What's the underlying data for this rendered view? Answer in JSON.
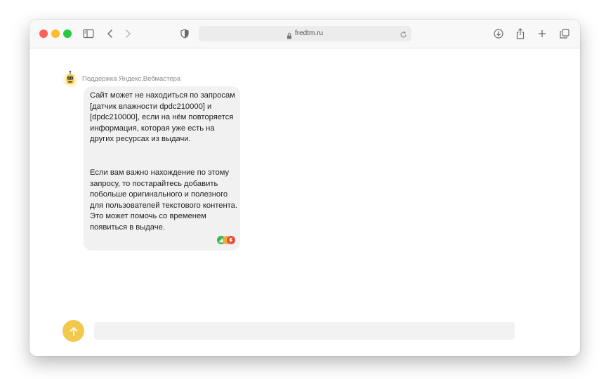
{
  "browser": {
    "url": "fredtm.ru"
  },
  "chat": {
    "sender_name": "Поддержка Яндекс.Вебмастера",
    "message": {
      "paragraph1": "Сайт может не находиться по запросам [датчик влажности dpdc210000] и [dpdc210000], если на нём повторяется информация, которая уже есть на других ресурсах из выдачи.",
      "paragraph2": "Если вам важно нахождение по этому запросу, то постарайтесь добавить побольше оригинального и полезного для пользователей текстового контента. Это может помочь со временем появиться в выдаче."
    },
    "input_value": ""
  },
  "icons": {
    "sidebar": "sidebar-icon",
    "back": "chevron-left-icon",
    "forward": "chevron-right-icon",
    "privacy": "shield-icon",
    "lock": "lock-icon",
    "reload": "reload-icon",
    "download": "download-icon",
    "share": "share-icon",
    "new_tab": "plus-icon",
    "tabs": "tabs-overview-icon",
    "send": "arrow-up-icon"
  },
  "colors": {
    "send_button": "#f2c94c",
    "bubble": "#f1f1f1",
    "close": "#ff5f57",
    "minimize": "#febc2e",
    "zoom": "#28c840"
  }
}
